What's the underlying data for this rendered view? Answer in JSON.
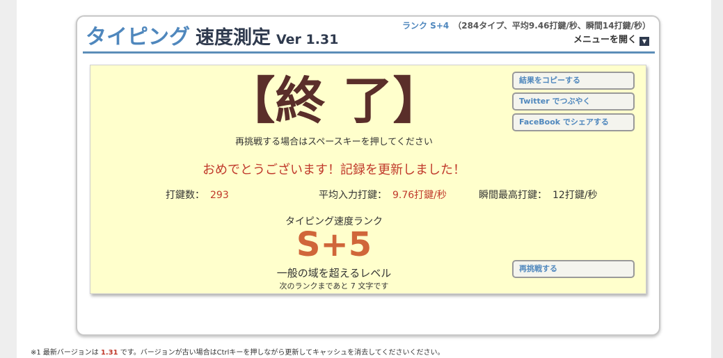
{
  "header": {
    "title_main": "タイピング",
    "title_sub": "速度測定",
    "version": "Ver 1.31",
    "rank_label": "ランク S+4",
    "rank_detail": "（284タイプ、平均9.46打鍵/秒、瞬間14打鍵/秒）",
    "menu_label": "メニューを開く",
    "menu_icon": "caret-down-icon"
  },
  "result": {
    "end_title": "【終 了】",
    "retry_hint": "再挑戦する場合はスペースキーを押してください",
    "congrats": "おめでとうございます！記録を更新しました！",
    "stats": {
      "keystrokes_label": "打鍵数：",
      "keystrokes_value": "293",
      "avg_label": "平均入力打鍵：",
      "avg_value": "9.76打鍵/秒",
      "peak_label": "瞬間最高打鍵：",
      "peak_value": "12打鍵/秒"
    },
    "rank_label": "タイピング速度ランク",
    "rank_value": "S+5",
    "rank_desc": "一般の域を超えるレベル",
    "rank_next": "次のランクまであと 7 文字です"
  },
  "buttons": {
    "copy_result": "結果をコピーする",
    "twitter": "Twitter でつぶやく",
    "facebook": "FaceBook でシェアする",
    "retry": "再挑戦する"
  },
  "footer": {
    "prefix": "※1 最新バージョンは",
    "latest_version": "1.31",
    "suffix": "です。バージョンが古い場合はCtrlキーを押しながら更新してキャッシュを消去してくださいください。"
  },
  "colors": {
    "accent": "#4f87bd",
    "panel_bg": "#ffffcc",
    "highlight": "#c0392b",
    "rank": "#d0663a",
    "end_title": "#5a2e2a"
  }
}
